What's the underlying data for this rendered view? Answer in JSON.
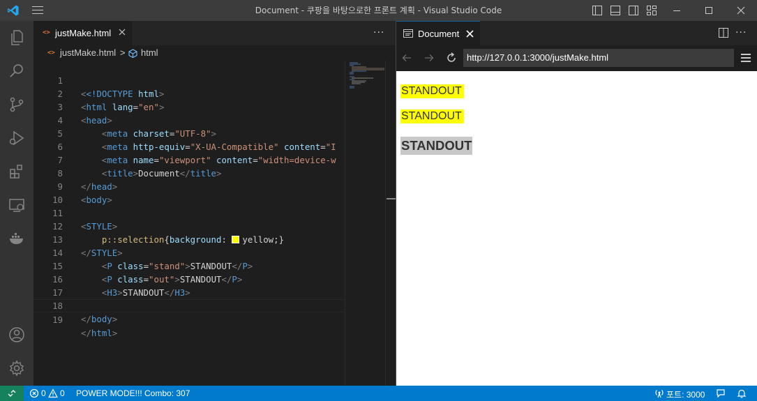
{
  "window": {
    "title": "Document - 쿠팡을 바탕으로한 프론트 계획 - Visual Studio Code"
  },
  "activity_bar": {
    "items": [
      "explorer-icon",
      "search-icon",
      "source-control-icon",
      "run-debug-icon",
      "extensions-icon",
      "remote-explorer-icon",
      "docker-icon"
    ],
    "bottom": [
      "accounts-icon",
      "settings-gear-icon"
    ]
  },
  "editor": {
    "tab": {
      "label": "justMake.html",
      "icon": "<>"
    },
    "breadcrumb": {
      "file": "justMake.html",
      "separator": ">",
      "symbol": "html"
    },
    "lines": [
      {
        "n": "1"
      },
      {
        "n": "2"
      },
      {
        "n": "3"
      },
      {
        "n": "4"
      },
      {
        "n": "5"
      },
      {
        "n": "6"
      },
      {
        "n": "7"
      },
      {
        "n": "8"
      },
      {
        "n": "9"
      },
      {
        "n": "10"
      },
      {
        "n": "11"
      },
      {
        "n": "12"
      },
      {
        "n": "13"
      },
      {
        "n": "14"
      },
      {
        "n": "15"
      },
      {
        "n": "16"
      },
      {
        "n": "17"
      },
      {
        "n": "18"
      },
      {
        "n": "19"
      }
    ],
    "code": {
      "l1_a": "<!DOCTYPE",
      "l1_b": "html",
      "l1_c": ">",
      "l2_tag": "html",
      "l2_attr": "lang",
      "l2_val": "\"en\"",
      "l3_tag": "head",
      "l4_tag": "meta",
      "l4_attr": "charset",
      "l4_val": "\"UTF-8\"",
      "l5_tag": "meta",
      "l5_attr1": "http-equiv",
      "l5_val1": "\"X-UA-Compatible\"",
      "l5_attr2": "content",
      "l5_val2": "\"I",
      "l6_tag": "meta",
      "l6_attr1": "name",
      "l6_val1": "\"viewport\"",
      "l6_attr2": "content",
      "l6_val2": "\"width=device-w",
      "l7_tag": "title",
      "l7_text": "Document",
      "l8_tag": "head",
      "l9_tag": "body",
      "l11_tag": "STYLE",
      "l12_sel": "p::selection",
      "l12_prop": "background",
      "l12_val": "yellow",
      "l13_tag": "STYLE",
      "l14_tag": "P",
      "l14_attr": "class",
      "l14_val": "\"stand\"",
      "l14_text": "STANDOUT",
      "l15_tag": "P",
      "l15_attr": "class",
      "l15_val": "\"out\"",
      "l15_text": "STANDOUT",
      "l16_tag": "H3",
      "l16_text": "STANDOUT",
      "l18_tag": "body",
      "l19_tag": "html"
    }
  },
  "preview": {
    "tab_label": "Document",
    "url": "http://127.0.0.1:3000/justMake.html",
    "page": {
      "p_stand": "STANDOUT",
      "p_out": "STANDOUT",
      "h3": "STANDOUT"
    },
    "colors": {
      "selection_bg": "#ffff00",
      "h3_bg": "#c8c8c8"
    }
  },
  "statusbar": {
    "errors": "0",
    "warnings": "0",
    "power_mode": "POWER MODE!!! Combo: 307",
    "port": "포트: 3000"
  },
  "colors": {
    "accent": "#007acc",
    "remote": "#16825d",
    "title_bar": "#3c3c3c",
    "activity_bar": "#333333"
  }
}
